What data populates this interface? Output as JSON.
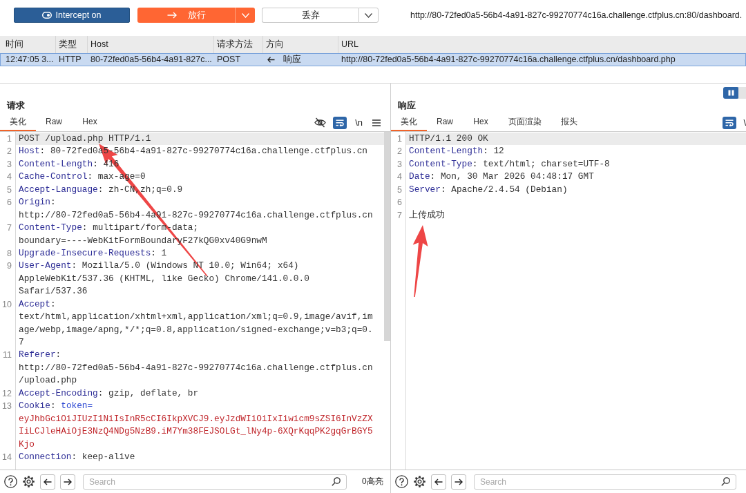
{
  "toolbar": {
    "intercept_label": "Intercept on",
    "forward_label": "放行",
    "drop_label": "丢弃",
    "url": "http://80-72fed0a5-56b4-4a91-827c-99270774c16a.challenge.ctfplus.cn:80/dashboard."
  },
  "history_table": {
    "columns": [
      "时间",
      "类型",
      "Host",
      "请求方法",
      "方向",
      "URL"
    ],
    "rows": [
      {
        "selected": true,
        "time": "12:47:05 3...",
        "type": "HTTP",
        "host": "80-72fed0a5-56b4-4a91-827c...",
        "method": "POST",
        "direction": "响应",
        "url": "http://80-72fed0a5-56b4-4a91-827c-99270774c16a.challenge.ctfplus.cn/dashboard.php"
      }
    ]
  },
  "request": {
    "title": "请求",
    "tabs": [
      {
        "label": "美化",
        "selected": true
      },
      {
        "label": "Raw",
        "selected": false
      },
      {
        "label": "Hex",
        "selected": false
      }
    ],
    "wrap": true,
    "newline_label": "\\n",
    "lines": [
      {
        "number": "1",
        "selected": true,
        "rows": [
          [
            {
              "kind": "text",
              "text": "POST /upload.php HTTP/1.1"
            }
          ]
        ]
      },
      {
        "number": "2",
        "selected": false,
        "rows": [
          [
            {
              "kind": "key",
              "text": "Host"
            },
            {
              "kind": "text",
              "text": ": 80-72fed0a5-56b4-4a91-827c-99270774c16a.challenge.ctfplus.cn"
            }
          ]
        ]
      },
      {
        "number": "3",
        "selected": false,
        "rows": [
          [
            {
              "kind": "key",
              "text": "Content-Length"
            },
            {
              "kind": "text",
              "text": ": 416"
            }
          ]
        ]
      },
      {
        "number": "4",
        "selected": false,
        "rows": [
          [
            {
              "kind": "key",
              "text": "Cache-Control"
            },
            {
              "kind": "text",
              "text": ": max-age=0"
            }
          ]
        ]
      },
      {
        "number": "5",
        "selected": false,
        "rows": [
          [
            {
              "kind": "key",
              "text": "Accept-Language"
            },
            {
              "kind": "text",
              "text": ": zh-CN,zh;q=0.9"
            }
          ]
        ]
      },
      {
        "number": "6",
        "selected": false,
        "rows": [
          [
            {
              "kind": "key",
              "text": "Origin"
            },
            {
              "kind": "text",
              "text": ":"
            }
          ],
          [
            {
              "kind": "text",
              "text": "http://80-72fed0a5-56b4-4a91-827c-99270774c16a.challenge.ctfplus.cn"
            }
          ]
        ]
      },
      {
        "number": "7",
        "selected": false,
        "rows": [
          [
            {
              "kind": "key",
              "text": "Content-Type"
            },
            {
              "kind": "text",
              "text": ": multipart/form-data;"
            }
          ],
          [
            {
              "kind": "text",
              "text": "boundary=----WebKitFormBoundaryF27kQG0xv40G9nwM"
            }
          ]
        ]
      },
      {
        "number": "8",
        "selected": false,
        "rows": [
          [
            {
              "kind": "key",
              "text": "Upgrade-Insecure-Requests"
            },
            {
              "kind": "text",
              "text": ": 1"
            }
          ]
        ]
      },
      {
        "number": "9",
        "selected": false,
        "rows": [
          [
            {
              "kind": "key",
              "text": "User-Agent"
            },
            {
              "kind": "text",
              "text": ": Mozilla/5.0 (Windows NT 10.0; Win64; x64)"
            }
          ],
          [
            {
              "kind": "text",
              "text": "AppleWebKit/537.36 (KHTML, like Gecko) Chrome/141.0.0.0"
            }
          ],
          [
            {
              "kind": "text",
              "text": "Safari/537.36"
            }
          ]
        ]
      },
      {
        "number": "10",
        "selected": false,
        "rows": [
          [
            {
              "kind": "key",
              "text": "Accept"
            },
            {
              "kind": "text",
              "text": ":"
            }
          ],
          [
            {
              "kind": "text",
              "text": "text/html,application/xhtml+xml,application/xml;q=0.9,image/avif,im"
            }
          ],
          [
            {
              "kind": "text",
              "text": "age/webp,image/apng,*/*;q=0.8,application/signed-exchange;v=b3;q=0."
            }
          ],
          [
            {
              "kind": "text",
              "text": "7"
            }
          ]
        ]
      },
      {
        "number": "11",
        "selected": false,
        "rows": [
          [
            {
              "kind": "key",
              "text": "Referer"
            },
            {
              "kind": "text",
              "text": ":"
            }
          ],
          [
            {
              "kind": "text",
              "text": "http://80-72fed0a5-56b4-4a91-827c-99270774c16a.challenge.ctfplus.cn"
            }
          ],
          [
            {
              "kind": "text",
              "text": "/upload.php"
            }
          ]
        ]
      },
      {
        "number": "12",
        "selected": false,
        "rows": [
          [
            {
              "kind": "key",
              "text": "Accept-Encoding"
            },
            {
              "kind": "text",
              "text": ": gzip, deflate, br"
            }
          ]
        ]
      },
      {
        "number": "13",
        "selected": false,
        "rows": [
          [
            {
              "kind": "key",
              "text": "Cookie"
            },
            {
              "kind": "text",
              "text": ": "
            },
            {
              "kind": "cookie_name",
              "text": "token="
            }
          ],
          [
            {
              "kind": "cookie_value",
              "text": "eyJhbGciOiJIUzI1NiIsInR5cCI6IkpXVCJ9.eyJzdWIiOiIxIiwicm9sZSI6InVzZX"
            }
          ],
          [
            {
              "kind": "cookie_value",
              "text": "IiLCJleHAiOjE3NzQ4NDg5NzB9.iM7Ym38FEJSOLGt_lNy4p-6XQrKqqPK2gqGrBGY5"
            }
          ],
          [
            {
              "kind": "cookie_value",
              "text": "Kjo"
            }
          ]
        ]
      },
      {
        "number": "14",
        "selected": false,
        "rows": [
          [
            {
              "kind": "key",
              "text": "Connection"
            },
            {
              "kind": "text",
              "text": ": keep-alive"
            }
          ]
        ]
      }
    ],
    "search": {
      "placeholder": "Search"
    },
    "highlight_count": "0高亮"
  },
  "response": {
    "title": "响应",
    "tabs": [
      {
        "label": "美化",
        "selected": true
      },
      {
        "label": "Raw",
        "selected": false
      },
      {
        "label": "Hex",
        "selected": false
      },
      {
        "label": "页面渲染",
        "selected": false
      },
      {
        "label": "报头",
        "selected": false
      }
    ],
    "wrap": true,
    "cut_label": "\\",
    "lines": [
      {
        "number": "1",
        "selected": true,
        "rows": [
          [
            {
              "kind": "text",
              "text": "HTTP/1.1 200 OK"
            }
          ]
        ]
      },
      {
        "number": "2",
        "selected": false,
        "rows": [
          [
            {
              "kind": "key",
              "text": "Content-Length"
            },
            {
              "kind": "text",
              "text": ": 12"
            }
          ]
        ]
      },
      {
        "number": "3",
        "selected": false,
        "rows": [
          [
            {
              "kind": "key",
              "text": "Content-Type"
            },
            {
              "kind": "text",
              "text": ": text/html; charset=UTF-8"
            }
          ]
        ]
      },
      {
        "number": "4",
        "selected": false,
        "rows": [
          [
            {
              "kind": "key",
              "text": "Date"
            },
            {
              "kind": "text",
              "text": ": Mon, 30 Mar 2026 04:48:17 GMT"
            }
          ]
        ]
      },
      {
        "number": "5",
        "selected": false,
        "rows": [
          [
            {
              "kind": "key",
              "text": "Server"
            },
            {
              "kind": "text",
              "text": ": Apache/2.4.54 (Debian)"
            }
          ]
        ]
      },
      {
        "number": "6",
        "selected": false
      },
      {
        "number": "7",
        "selected": false,
        "rows": [
          [
            {
              "kind": "text",
              "text": "上传成功"
            }
          ]
        ]
      }
    ],
    "search": {
      "placeholder": "Search"
    }
  }
}
